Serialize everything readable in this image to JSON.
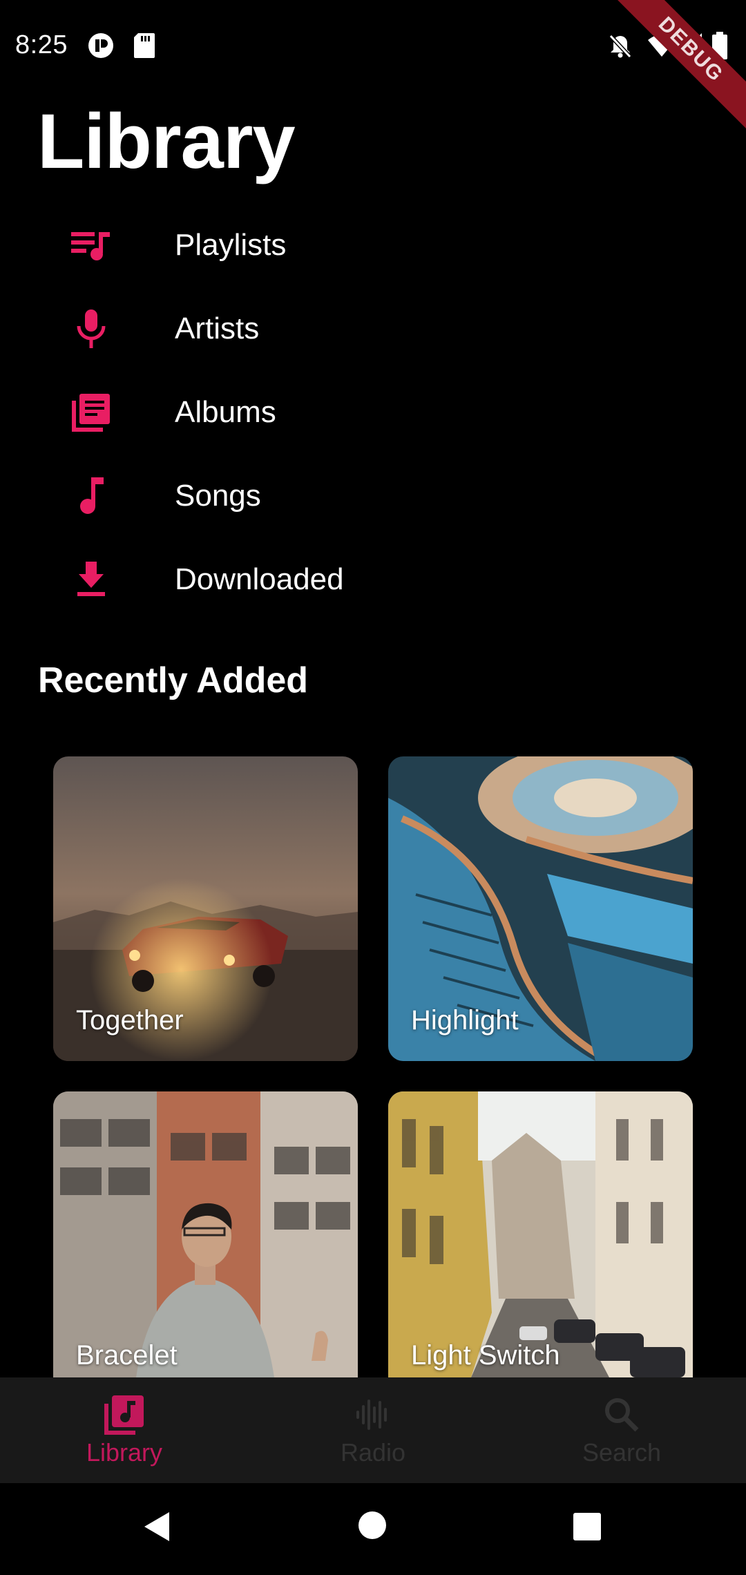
{
  "status": {
    "time": "8:25",
    "debug_banner": "DEBUG"
  },
  "page": {
    "title": "Library"
  },
  "nav_items": [
    {
      "label": "Playlists",
      "icon": "playlist-icon"
    },
    {
      "label": "Artists",
      "icon": "microphone-icon"
    },
    {
      "label": "Albums",
      "icon": "album-library-icon"
    },
    {
      "label": "Songs",
      "icon": "music-note-icon"
    },
    {
      "label": "Downloaded",
      "icon": "download-icon"
    }
  ],
  "recently_added": {
    "title": "Recently Added",
    "items": [
      {
        "label": "Together"
      },
      {
        "label": "Highlight"
      },
      {
        "label": "Bracelet"
      },
      {
        "label": "Light Switch"
      }
    ]
  },
  "tabs": [
    {
      "label": "Library",
      "icon": "library-music-icon",
      "active": true
    },
    {
      "label": "Radio",
      "icon": "radio-wave-icon",
      "active": false
    },
    {
      "label": "Search",
      "icon": "search-icon",
      "active": false
    }
  ],
  "colors": {
    "accent": "#e91e63",
    "accent_active_tab": "#c2185b",
    "inactive_tab": "#333333",
    "background": "#000000",
    "tab_bar": "#191919"
  }
}
